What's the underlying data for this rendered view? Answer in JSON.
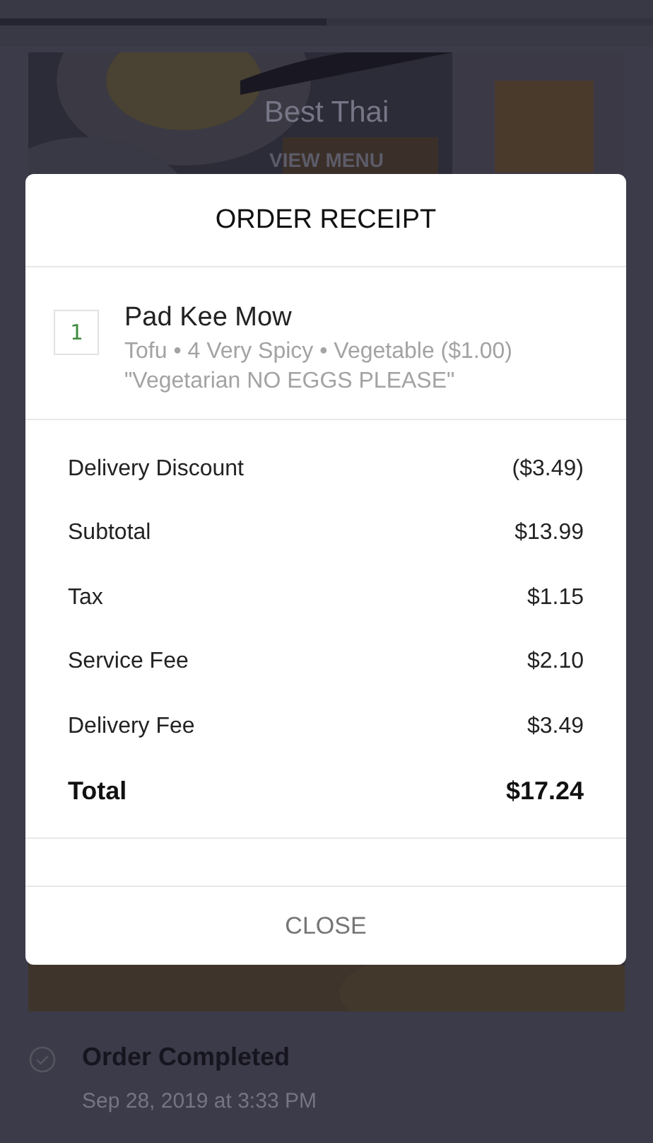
{
  "progress": {
    "level": 0.5
  },
  "restaurant": {
    "name": "Best Thai",
    "link": "VIEW MENU"
  },
  "status": {
    "label": "Order Completed",
    "date": "Sep 28, 2019 at 3:33 PM",
    "done": true
  },
  "receipt": {
    "title": "ORDER RECEIPT",
    "items": [
      {
        "quantity": "1",
        "name": "Pad Kee Mow",
        "options": "Tofu • 4 Very Spicy • Vegetable ($1.00)",
        "note": "\"Vegetarian NO EGGS PLEASE\""
      }
    ],
    "lines": [
      {
        "label": "Delivery Discount",
        "amount": "($3.49)",
        "kind": "normal"
      },
      {
        "label": "Subtotal",
        "amount": "$13.99",
        "kind": "normal"
      },
      {
        "label": "Tax",
        "amount": "$1.15",
        "kind": "normal"
      },
      {
        "label": "Service Fee",
        "amount": "$2.10",
        "kind": "normal"
      },
      {
        "label": "Delivery Fee",
        "amount": "$3.49",
        "kind": "normal"
      },
      {
        "label": "Total",
        "amount": "$17.24",
        "kind": "total"
      }
    ],
    "close": "CLOSE"
  }
}
